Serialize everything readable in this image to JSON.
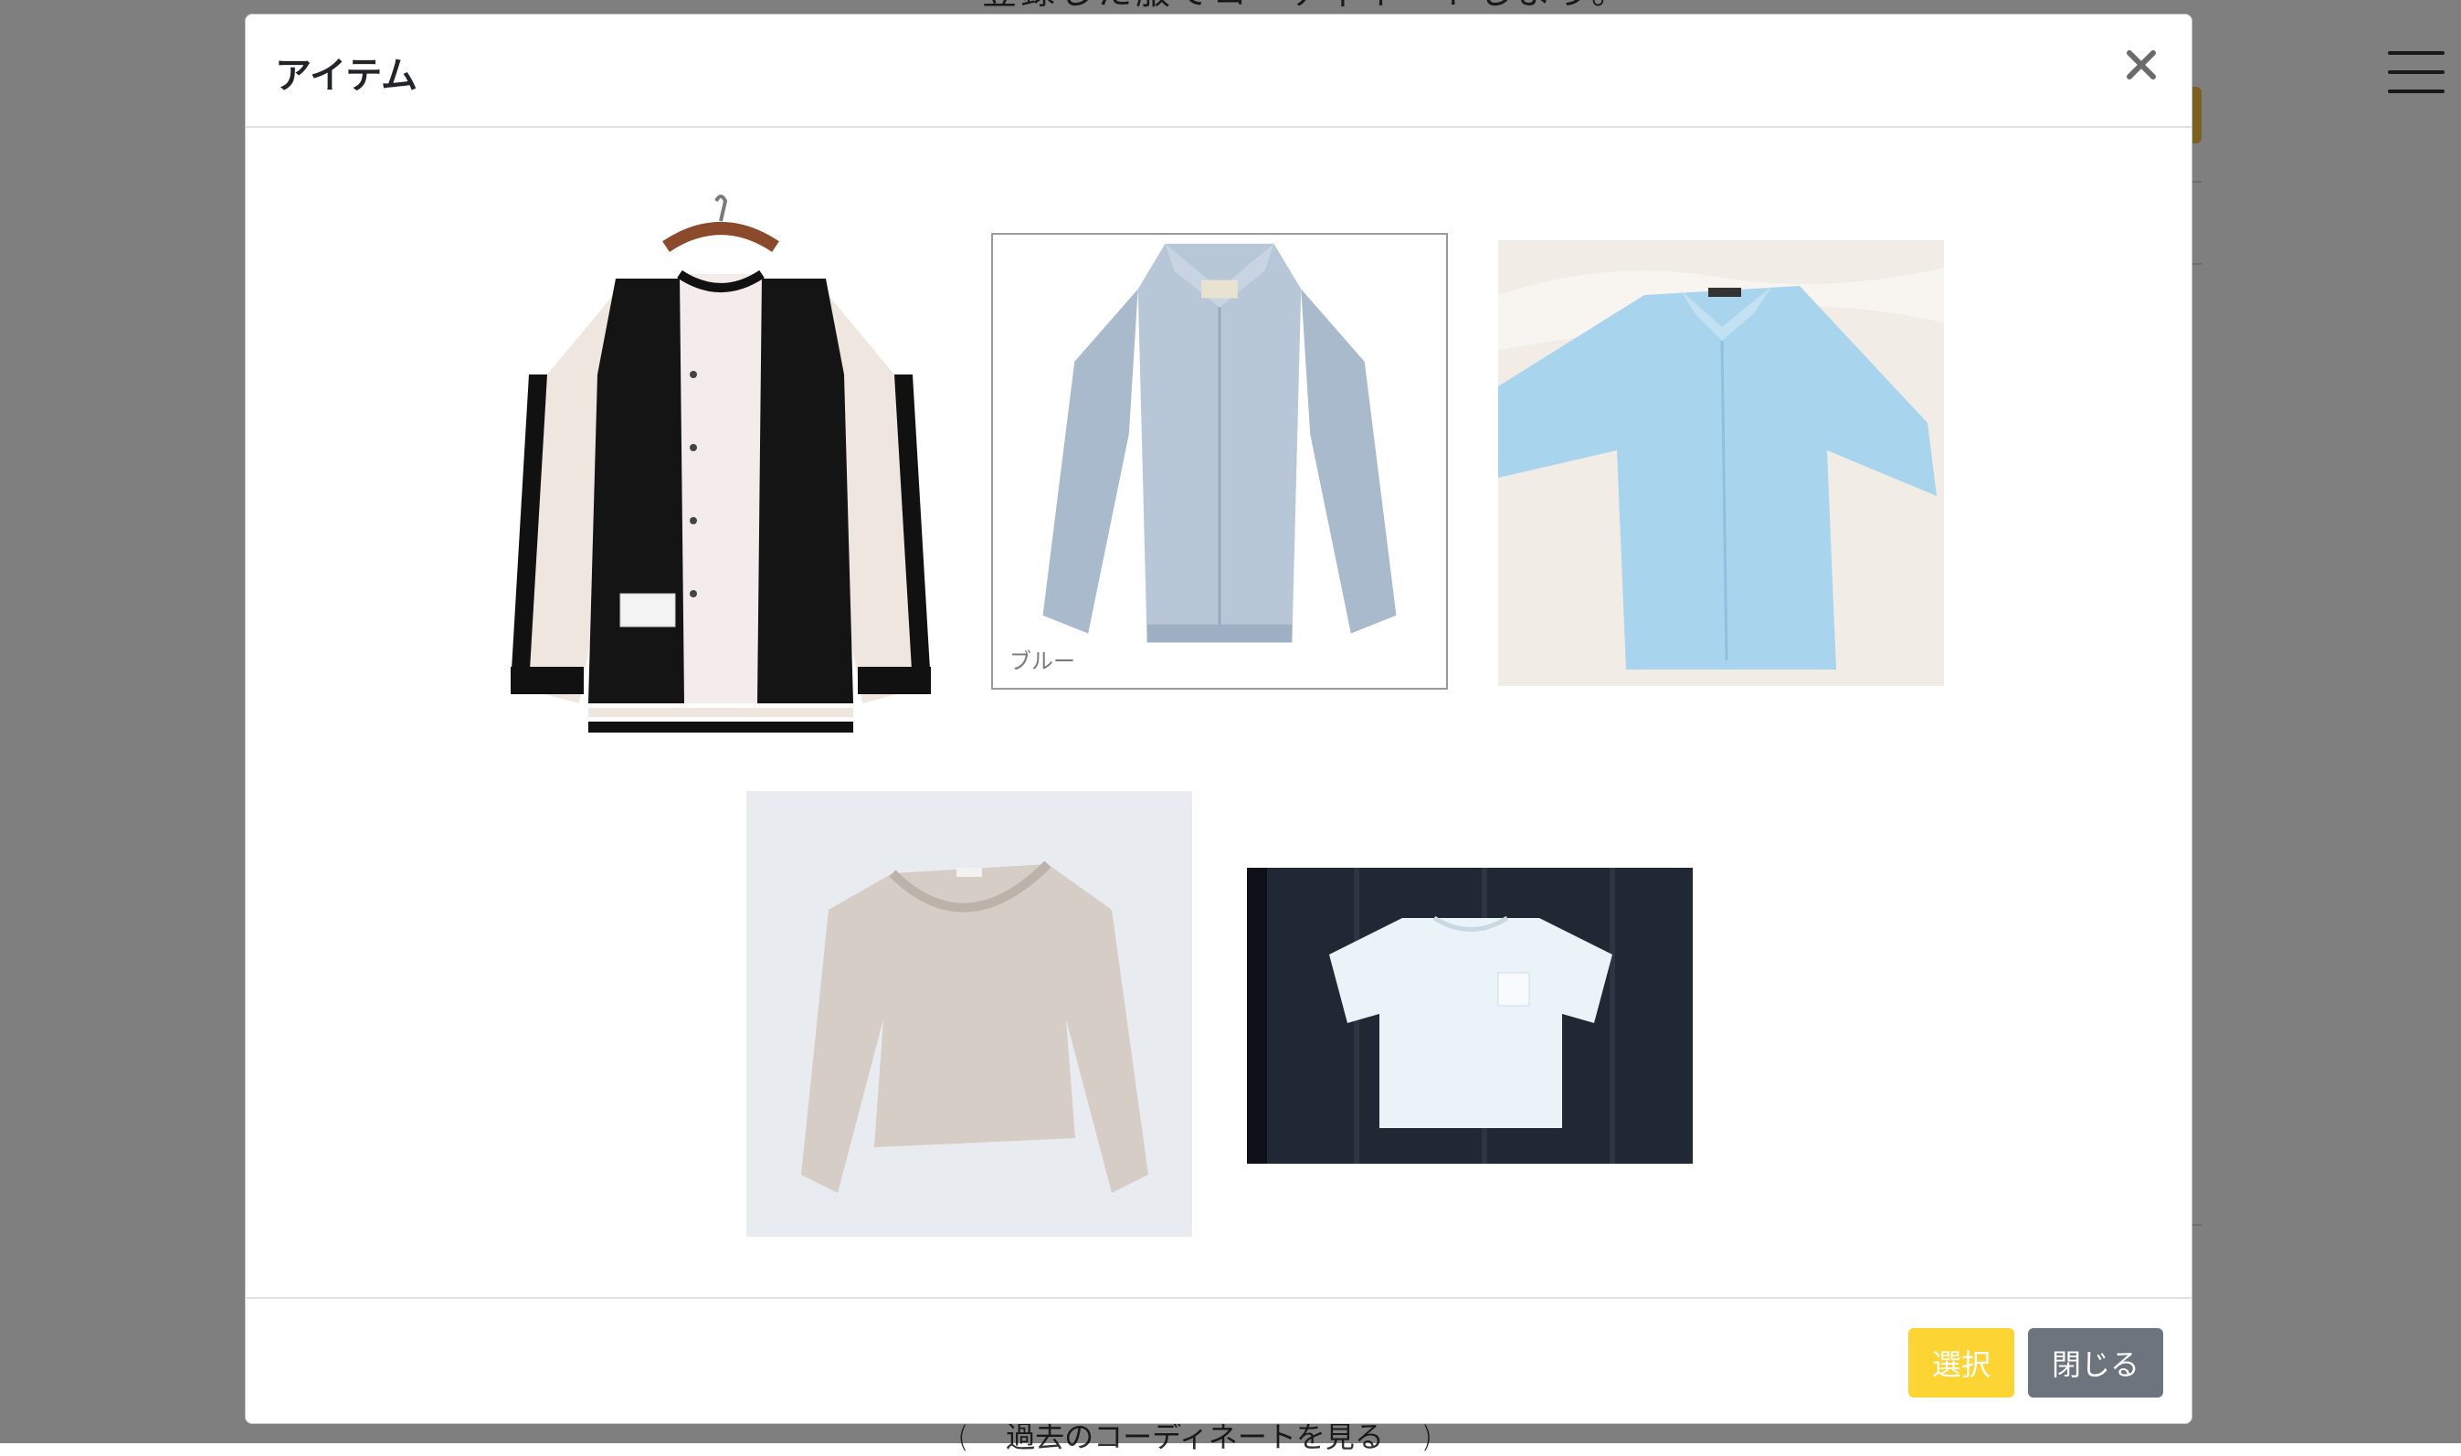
{
  "background": {
    "top_text": "登録した服でコーディネートしよう。",
    "bottom_link": "過去のコーディネートを見る"
  },
  "modal": {
    "title": "アイテム",
    "close_icon": "close-icon",
    "items": [
      {
        "name": "bomber-jacket",
        "alt": "jacket"
      },
      {
        "name": "blue-jacket",
        "caption": "ブルー"
      },
      {
        "name": "light-blue-shirt"
      },
      {
        "name": "beige-sweater"
      },
      {
        "name": "white-tshirt"
      }
    ],
    "footer": {
      "select_label": "選択",
      "close_label": "閉じる"
    }
  },
  "colors": {
    "select_button": "#fcd535",
    "close_button": "#6c757d",
    "backdrop": "rgba(0,0,0,0.5)"
  }
}
